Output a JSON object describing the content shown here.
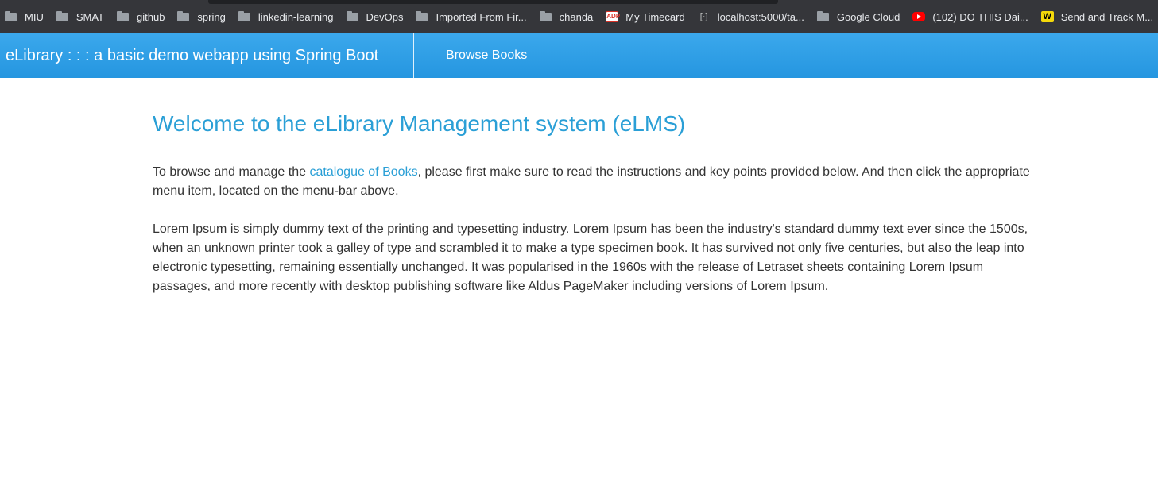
{
  "bookmarks": [
    {
      "label": "MIU",
      "icon": "folder-icon"
    },
    {
      "label": "SMAT",
      "icon": "folder-icon"
    },
    {
      "label": "github",
      "icon": "folder-icon"
    },
    {
      "label": "spring",
      "icon": "folder-icon"
    },
    {
      "label": "linkedin-learning",
      "icon": "folder-icon"
    },
    {
      "label": "DevOps",
      "icon": "folder-icon"
    },
    {
      "label": "Imported From Fir...",
      "icon": "folder-icon"
    },
    {
      "label": "chanda",
      "icon": "folder-icon"
    },
    {
      "label": "My Timecard",
      "icon": "adp-icon",
      "icon_text": "ADP"
    },
    {
      "label": "localhost:5000/ta...",
      "icon": "localhost-icon",
      "icon_text": "[·]"
    },
    {
      "label": "Google Cloud",
      "icon": "folder-icon"
    },
    {
      "label": "(102) DO THIS Dai...",
      "icon": "youtube-icon"
    },
    {
      "label": "Send and Track M...",
      "icon": "track-icon",
      "icon_text": "W"
    }
  ],
  "navbar": {
    "brand": "eLibrary : : : a basic demo webapp using Spring Boot",
    "browse_books": "Browse Books"
  },
  "main": {
    "title": "Welcome to the eLibrary Management system (eLMS)",
    "intro_before": "To browse and manage the ",
    "intro_link": "catalogue of Books",
    "intro_after": ", please first make sure to read the instructions and key points provided below. And then click the appropriate menu item, located on the menu-bar above.",
    "lorem": "Lorem Ipsum is simply dummy text of the printing and typesetting industry. Lorem Ipsum has been the industry's standard dummy text ever since the 1500s, when an unknown printer took a galley of type and scrambled it to make a type specimen book. It has survived not only five centuries, but also the leap into electronic typesetting, remaining essentially unchanged. It was popularised in the 1960s with the release of Letraset sheets containing Lorem Ipsum passages, and more recently with desktop publishing software like Aldus PageMaker including versions of Lorem Ipsum."
  },
  "colors": {
    "navbar": "#2596e0",
    "accent": "#2a9fd6",
    "bookmarks_bar": "#35363a"
  }
}
